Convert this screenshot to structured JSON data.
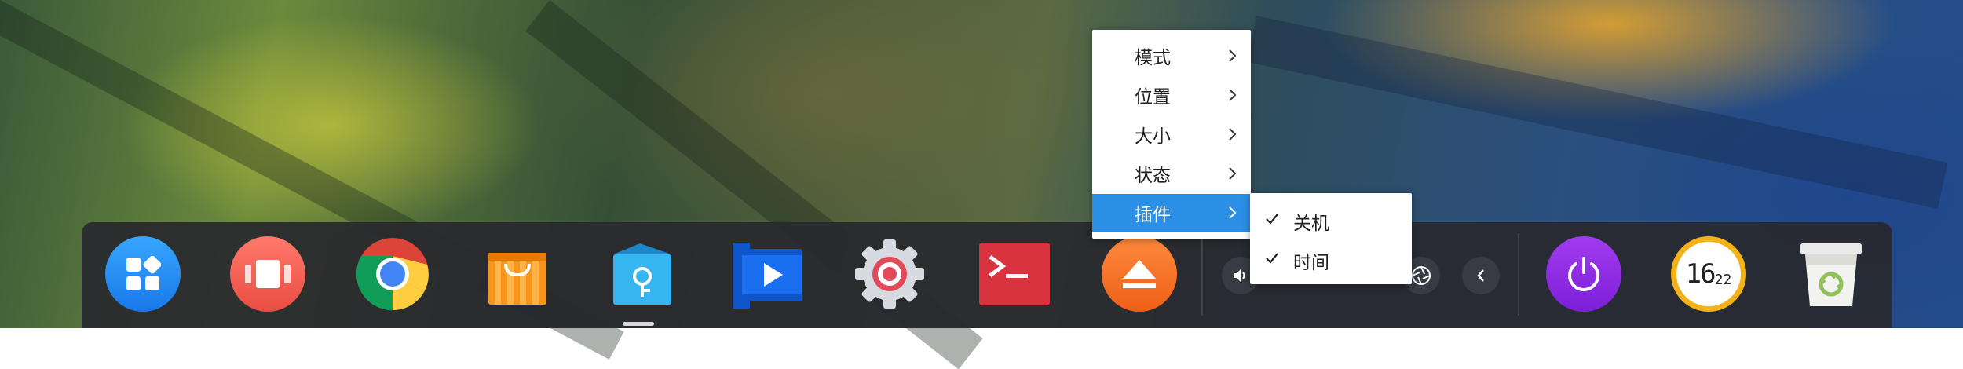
{
  "context_menu": {
    "items": [
      {
        "label": "模式",
        "has_submenu": true
      },
      {
        "label": "位置",
        "has_submenu": true
      },
      {
        "label": "大小",
        "has_submenu": true
      },
      {
        "label": "状态",
        "has_submenu": true
      },
      {
        "label": "插件",
        "has_submenu": true,
        "active": true
      }
    ]
  },
  "plugin_submenu": {
    "items": [
      {
        "label": "关机",
        "checked": true
      },
      {
        "label": "时间",
        "checked": true
      }
    ]
  },
  "dock": {
    "apps": [
      {
        "icon": "launcher-icon",
        "color": "#1e90ff"
      },
      {
        "icon": "multitasking-icon",
        "color": "#f05a4f"
      },
      {
        "icon": "chrome-icon"
      },
      {
        "icon": "app-store-icon",
        "color": "#f7941d"
      },
      {
        "icon": "file-manager-icon",
        "color": "#35b6f0"
      },
      {
        "icon": "video-player-icon",
        "color": "#1a6ff0"
      },
      {
        "icon": "settings-icon",
        "color": "#e24a5a"
      },
      {
        "icon": "terminal-icon",
        "color": "#d9333f"
      },
      {
        "icon": "eject-icon",
        "color": "#f26b22"
      }
    ],
    "tray": [
      {
        "icon": "volume-icon"
      },
      {
        "icon": "fan-icon"
      },
      {
        "icon": "chevron-left-icon"
      }
    ],
    "plugins": [
      {
        "icon": "power-icon",
        "color": "#8a2be2"
      },
      {
        "icon": "clock-icon",
        "time_hour": "16",
        "time_minute": "22"
      },
      {
        "icon": "trash-icon"
      }
    ]
  }
}
